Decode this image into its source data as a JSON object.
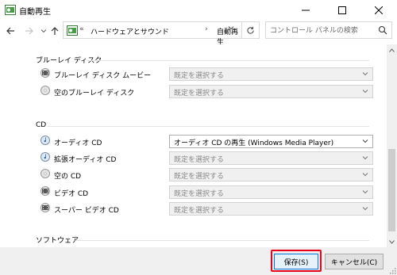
{
  "window": {
    "title": "自動再生"
  },
  "nav": {
    "address_prefix": "«",
    "crumb_parent": "ハードウェアとサウンド",
    "separator": "›",
    "crumb_current": "自動再生",
    "search_placeholder": "コントロール パネルの検索"
  },
  "sections": {
    "bluray": {
      "heading": "ブルーレイ ディスク",
      "rows": [
        {
          "label": "ブルーレイ ディスク ムービー",
          "value": "既定を選択する",
          "icon": "bluray-movie-icon"
        },
        {
          "label": "空のブルーレイ ディスク",
          "value": "既定を選択する",
          "icon": "blank-disc-icon"
        }
      ]
    },
    "cd": {
      "heading": "CD",
      "rows": [
        {
          "label": "オーディオ CD",
          "value": "オーディオ CD の再生 (Windows Media Player)",
          "icon": "audio-cd-icon"
        },
        {
          "label": "拡張オーディオ CD",
          "value": "既定を選択する",
          "icon": "enhanced-audio-cd-icon"
        },
        {
          "label": "空の CD",
          "value": "既定を選択する",
          "icon": "blank-cd-icon"
        },
        {
          "label": "ビデオ CD",
          "value": "既定を選択する",
          "icon": "video-cd-icon"
        },
        {
          "label": "スーパー ビデオ CD",
          "value": "既定を選択する",
          "icon": "super-video-cd-icon"
        }
      ]
    },
    "software": {
      "heading": "ソフトウェア"
    }
  },
  "footer": {
    "save_label": "保存(S)",
    "cancel_label": "キャンセル(C)"
  },
  "colors": {
    "highlight": "#e8001c",
    "accent": "#0078d7"
  }
}
